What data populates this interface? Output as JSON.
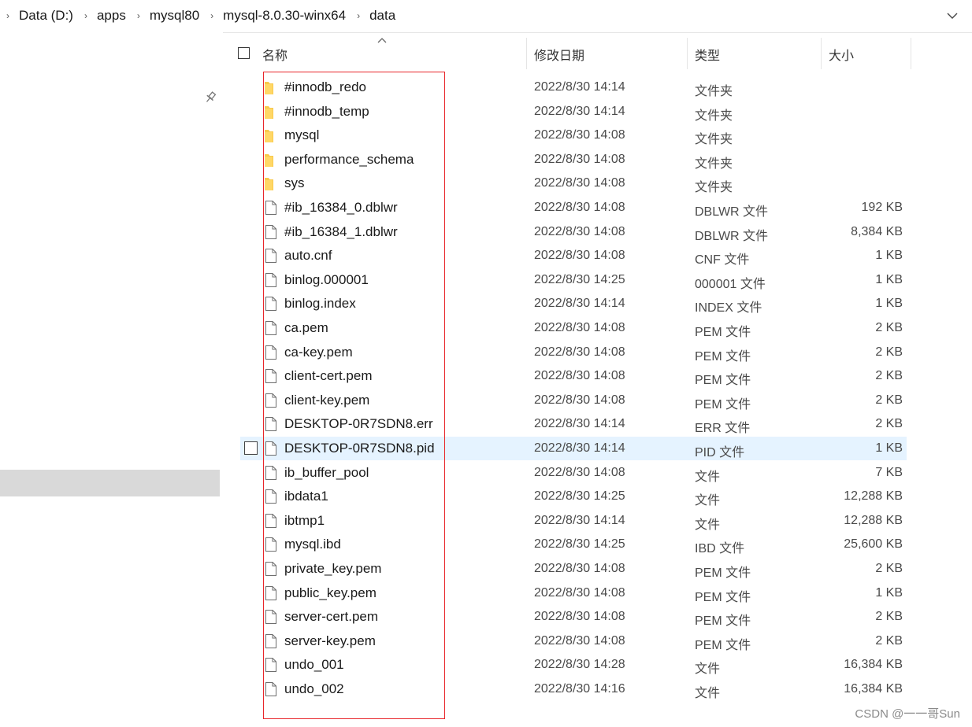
{
  "address_bar": {
    "breadcrumbs": [
      "Data (D:)",
      "apps",
      "mysql80",
      "mysql-8.0.30-winx64",
      "data"
    ]
  },
  "columns": {
    "name": "名称",
    "date": "修改日期",
    "type": "类型",
    "size": "大小"
  },
  "files": [
    {
      "name": "#innodb_redo",
      "date": "2022/8/30 14:14",
      "type": "文件夹",
      "size": "",
      "kind": "folder"
    },
    {
      "name": "#innodb_temp",
      "date": "2022/8/30 14:14",
      "type": "文件夹",
      "size": "",
      "kind": "folder"
    },
    {
      "name": "mysql",
      "date": "2022/8/30 14:08",
      "type": "文件夹",
      "size": "",
      "kind": "folder"
    },
    {
      "name": "performance_schema",
      "date": "2022/8/30 14:08",
      "type": "文件夹",
      "size": "",
      "kind": "folder"
    },
    {
      "name": "sys",
      "date": "2022/8/30 14:08",
      "type": "文件夹",
      "size": "",
      "kind": "folder"
    },
    {
      "name": "#ib_16384_0.dblwr",
      "date": "2022/8/30 14:08",
      "type": "DBLWR 文件",
      "size": "192 KB",
      "kind": "file"
    },
    {
      "name": "#ib_16384_1.dblwr",
      "date": "2022/8/30 14:08",
      "type": "DBLWR 文件",
      "size": "8,384 KB",
      "kind": "file"
    },
    {
      "name": "auto.cnf",
      "date": "2022/8/30 14:08",
      "type": "CNF 文件",
      "size": "1 KB",
      "kind": "file"
    },
    {
      "name": "binlog.000001",
      "date": "2022/8/30 14:25",
      "type": "000001 文件",
      "size": "1 KB",
      "kind": "file"
    },
    {
      "name": "binlog.index",
      "date": "2022/8/30 14:14",
      "type": "INDEX 文件",
      "size": "1 KB",
      "kind": "file"
    },
    {
      "name": "ca.pem",
      "date": "2022/8/30 14:08",
      "type": "PEM 文件",
      "size": "2 KB",
      "kind": "file"
    },
    {
      "name": "ca-key.pem",
      "date": "2022/8/30 14:08",
      "type": "PEM 文件",
      "size": "2 KB",
      "kind": "file"
    },
    {
      "name": "client-cert.pem",
      "date": "2022/8/30 14:08",
      "type": "PEM 文件",
      "size": "2 KB",
      "kind": "file"
    },
    {
      "name": "client-key.pem",
      "date": "2022/8/30 14:08",
      "type": "PEM 文件",
      "size": "2 KB",
      "kind": "file"
    },
    {
      "name": "DESKTOP-0R7SDN8.err",
      "date": "2022/8/30 14:14",
      "type": "ERR 文件",
      "size": "2 KB",
      "kind": "file"
    },
    {
      "name": "DESKTOP-0R7SDN8.pid",
      "date": "2022/8/30 14:14",
      "type": "PID 文件",
      "size": "1 KB",
      "kind": "file",
      "hovered": true
    },
    {
      "name": "ib_buffer_pool",
      "date": "2022/8/30 14:08",
      "type": "文件",
      "size": "7 KB",
      "kind": "file"
    },
    {
      "name": "ibdata1",
      "date": "2022/8/30 14:25",
      "type": "文件",
      "size": "12,288 KB",
      "kind": "file"
    },
    {
      "name": "ibtmp1",
      "date": "2022/8/30 14:14",
      "type": "文件",
      "size": "12,288 KB",
      "kind": "file"
    },
    {
      "name": "mysql.ibd",
      "date": "2022/8/30 14:25",
      "type": "IBD 文件",
      "size": "25,600 KB",
      "kind": "file"
    },
    {
      "name": "private_key.pem",
      "date": "2022/8/30 14:08",
      "type": "PEM 文件",
      "size": "2 KB",
      "kind": "file"
    },
    {
      "name": "public_key.pem",
      "date": "2022/8/30 14:08",
      "type": "PEM 文件",
      "size": "1 KB",
      "kind": "file"
    },
    {
      "name": "server-cert.pem",
      "date": "2022/8/30 14:08",
      "type": "PEM 文件",
      "size": "2 KB",
      "kind": "file"
    },
    {
      "name": "server-key.pem",
      "date": "2022/8/30 14:08",
      "type": "PEM 文件",
      "size": "2 KB",
      "kind": "file"
    },
    {
      "name": "undo_001",
      "date": "2022/8/30 14:28",
      "type": "文件",
      "size": "16,384 KB",
      "kind": "file"
    },
    {
      "name": "undo_002",
      "date": "2022/8/30 14:16",
      "type": "文件",
      "size": "16,384 KB",
      "kind": "file"
    }
  ],
  "icons": {
    "folder": "folder-icon",
    "file": "file-icon",
    "pin": "pin-icon",
    "chevron": "chevron-right-icon",
    "expand": "chevron-down-icon"
  },
  "colors": {
    "folder": "#f8c94c",
    "hover_row": "#e5f3ff",
    "annotation": "#e8262b",
    "nav_selected": "#d9d9d9"
  },
  "watermark": "CSDN @一一哥Sun"
}
